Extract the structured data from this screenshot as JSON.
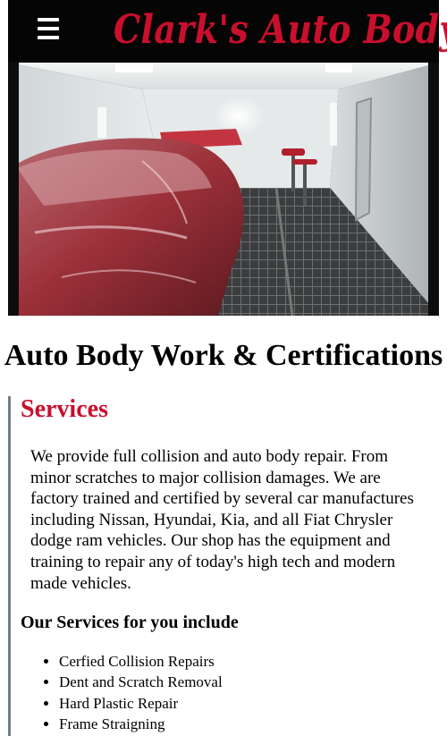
{
  "header": {
    "menu_icon": "hamburger-menu-icon",
    "logo_text": "Clark's Auto Body",
    "logo_color": "#c8102e"
  },
  "hero": {
    "alt": "Red car wrapped in plastic inside paint booth"
  },
  "page": {
    "title": "Auto Body Work & Certifications"
  },
  "services": {
    "title": "Services",
    "description": "We provide full collision and auto body repair. From minor scratches to major collision damages. We are factory trained and certified by several car manufactures including Nissan, Hyundai, Kia, and all Fiat Chrysler dodge ram vehicles. Our shop has the equipment and training to repair any of today's high tech and modern made vehicles.",
    "list_heading": "Our Services for you include",
    "items": [
      "Cerfied Collision Repairs",
      "Dent and Scratch Removal",
      "Hard Plastic Repair",
      "Frame Straigning"
    ]
  }
}
